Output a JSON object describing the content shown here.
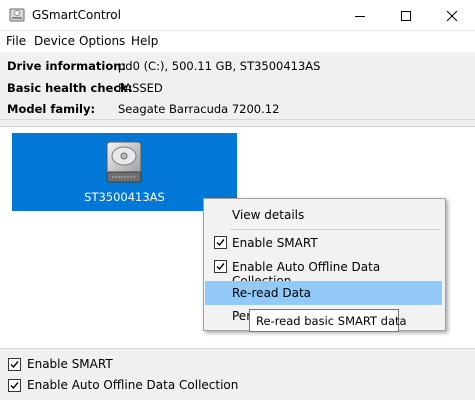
{
  "window": {
    "title": "GSmartControl",
    "icon": "hard-disk-icon"
  },
  "menubar": {
    "items": [
      {
        "label": "File"
      },
      {
        "label": "Device"
      },
      {
        "label": "Options"
      },
      {
        "label": "Help"
      }
    ]
  },
  "info": {
    "drive_label": "Drive information:",
    "drive_value": "pd0 (C:), 500.11 GB, ST3500413AS",
    "health_label": "Basic health check:",
    "health_value": "PASSED",
    "model_label": "Model family:",
    "model_value": "Seagate Barracuda 7200.12"
  },
  "drive": {
    "name": "ST3500413AS",
    "icon": "hard-disk-icon",
    "selected_color": "#0078d7"
  },
  "context_menu": {
    "view_details": "View details",
    "enable_smart": "Enable SMART",
    "enable_smart_checked": true,
    "enable_offline": "Enable Auto Offline Data Collection",
    "enable_offline_checked": true,
    "reread": "Re-read Data",
    "perform_partial": "Per",
    "highlight_color": "#91c9f7"
  },
  "tooltip": {
    "text": "Re-read basic SMART data"
  },
  "bottom": {
    "enable_smart": "Enable SMART",
    "enable_smart_checked": true,
    "enable_offline": "Enable Auto Offline Data Collection",
    "enable_offline_checked": true
  }
}
